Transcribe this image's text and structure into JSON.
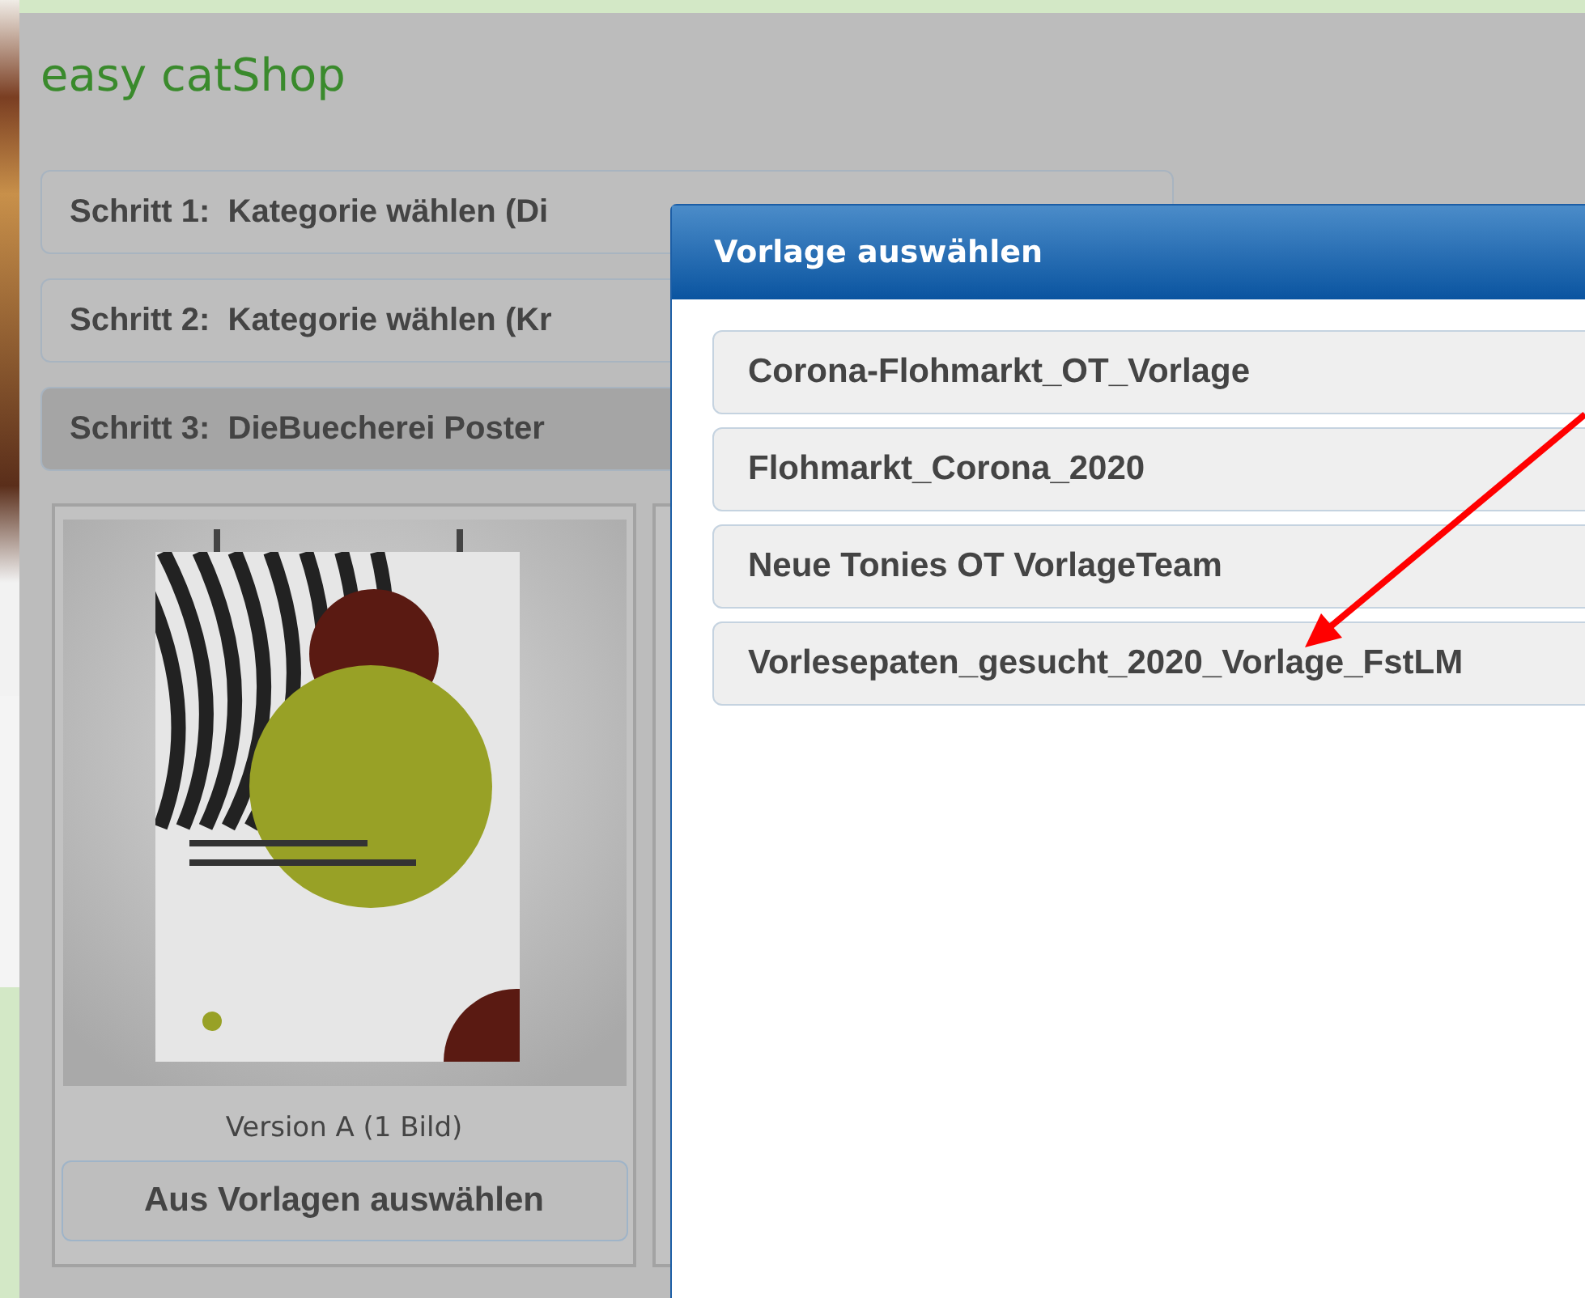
{
  "shop_title": "easy catShop",
  "steps": [
    {
      "label": "Schritt 1:  Kategorie wählen (Di",
      "selected": false
    },
    {
      "label": "Schritt 2:  Kategorie wählen (Kr",
      "selected": false
    },
    {
      "label": "Schritt 3:  DieBuecherei Poster",
      "selected": true
    }
  ],
  "cards": [
    {
      "caption": "Version A (1 Bild)",
      "button": "Aus Vorlagen auswählen"
    }
  ],
  "dialog": {
    "title": "Vorlage auswählen",
    "templates": [
      {
        "label": "Corona-Flohmarkt_OT_Vorlage"
      },
      {
        "label": "Flohmarkt_Corona_2020"
      },
      {
        "label": "Neue Tonies OT VorlageTeam"
      },
      {
        "label": "Vorlesepaten_gesucht_2020_Vorlage_FstLM"
      }
    ]
  }
}
